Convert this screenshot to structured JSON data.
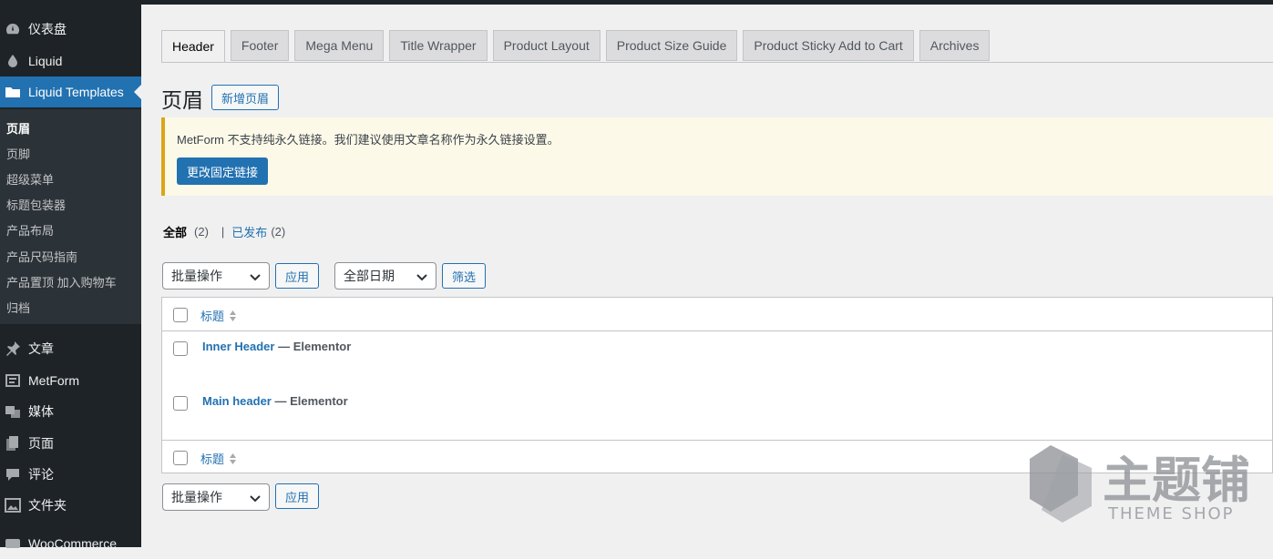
{
  "sidebar": {
    "items": [
      {
        "label": "仪表盘",
        "icon": "dashboard-icon"
      },
      {
        "label": "Liquid",
        "icon": "drop-icon"
      },
      {
        "label": "Liquid Templates",
        "icon": "folder-icon"
      },
      {
        "label": "文章",
        "icon": "pin-icon"
      },
      {
        "label": "MetForm",
        "icon": "form-icon"
      },
      {
        "label": "媒体",
        "icon": "media-icon"
      },
      {
        "label": "页面",
        "icon": "page-icon"
      },
      {
        "label": "评论",
        "icon": "comment-icon"
      },
      {
        "label": "文件夹",
        "icon": "image-folder-icon"
      },
      {
        "label": "WooCommerce",
        "icon": "woocommerce-icon"
      }
    ],
    "submenu": [
      "页眉",
      "页脚",
      "超级菜单",
      "标题包装器",
      "产品布局",
      "产品尺码指南",
      "产品置顶 加入购物车",
      "归档"
    ]
  },
  "tabs": [
    "Header",
    "Footer",
    "Mega Menu",
    "Title Wrapper",
    "Product Layout",
    "Product Size Guide",
    "Product Sticky Add to Cart",
    "Archives"
  ],
  "page": {
    "title": "页眉",
    "add_new": "新增页眉"
  },
  "notice": {
    "text": "MetForm 不支持纯永久链接。我们建议使用文章名称作为永久链接设置。",
    "button": "更改固定链接"
  },
  "filters": {
    "all": "全部",
    "all_count": "(2)",
    "separator": "|",
    "published": "已发布",
    "published_count": "(2)"
  },
  "toolbar": {
    "bulk_action": "批量操作",
    "apply": "应用",
    "date_filter": "全部日期",
    "filter": "筛选"
  },
  "table": {
    "column_title": "标题",
    "rows": [
      {
        "title": "Inner Header",
        "suffix": " — Elementor"
      },
      {
        "title": "Main header",
        "suffix": " — Elementor"
      }
    ]
  },
  "watermark": {
    "brand": "主题铺",
    "subtitle": "THEME SHOP"
  },
  "colors": {
    "sidebar_bg": "#1d2327",
    "accent": "#2271b1",
    "notice_border": "#dba617"
  }
}
